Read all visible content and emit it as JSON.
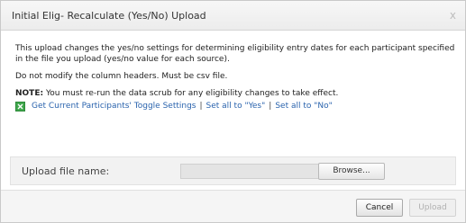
{
  "dialog": {
    "title": "Initial Elig- Recalculate (Yes/No) Upload",
    "close_symbol": "x",
    "close_icon": "close-icon"
  },
  "content": {
    "intro": "This upload changes the yes/no settings for determining eligibility entry dates for each participant specified in the file you upload (yes/no value for each source).",
    "instruction": "Do not modify the column headers. Must be csv file.",
    "note_label": "NOTE:",
    "note_text": " You must re-run the data scrub for any eligibility changes to take effect.",
    "links": {
      "icon": "excel-icon",
      "get_settings": "Get Current Participants' Toggle Settings",
      "separator": "|",
      "set_yes": "Set all to \"Yes\"",
      "set_no": "Set all to \"No\""
    }
  },
  "upload": {
    "label": "Upload file name:",
    "file_value": "",
    "browse_label": "Browse..."
  },
  "footer": {
    "cancel_label": "Cancel",
    "upload_label": "Upload"
  },
  "colors": {
    "link": "#2a63ad",
    "excel_green": "#2e8b3a"
  }
}
